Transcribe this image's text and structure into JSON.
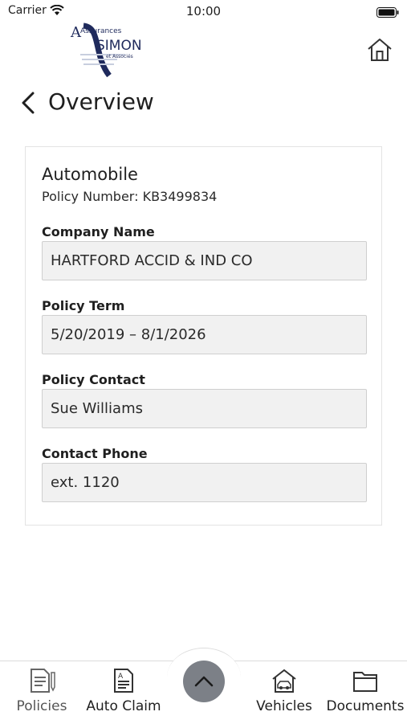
{
  "status_bar": {
    "carrier": "Carrier",
    "time": "10:00"
  },
  "header": {
    "logo": {
      "line1": "Assurances",
      "line2": "SIMON",
      "line3": "et Associés"
    },
    "title": "Overview"
  },
  "policy": {
    "type": "Automobile",
    "number_text": "Policy Number: KB3499834",
    "fields": [
      {
        "label": "Company Name",
        "value": "HARTFORD ACCID & IND CO"
      },
      {
        "label": "Policy Term",
        "value": "5/20/2019 – 8/1/2026"
      },
      {
        "label": "Policy Contact",
        "value": "Sue Williams"
      },
      {
        "label": "Contact Phone",
        "value": "ext. 1120"
      }
    ]
  },
  "tab_bar": {
    "tabs": [
      {
        "label": "Policies",
        "icon": "policies-icon",
        "active": true
      },
      {
        "label": "Auto Claim",
        "icon": "auto-claim-icon",
        "active": false
      },
      {
        "label": "Vehicles",
        "icon": "vehicles-icon",
        "active": false
      },
      {
        "label": "Documents",
        "icon": "documents-icon",
        "active": false
      }
    ],
    "center_button_icon": "chevron-up-icon"
  },
  "colors": {
    "accent": "#1f2a5c",
    "button_gray": "#7c8087"
  }
}
